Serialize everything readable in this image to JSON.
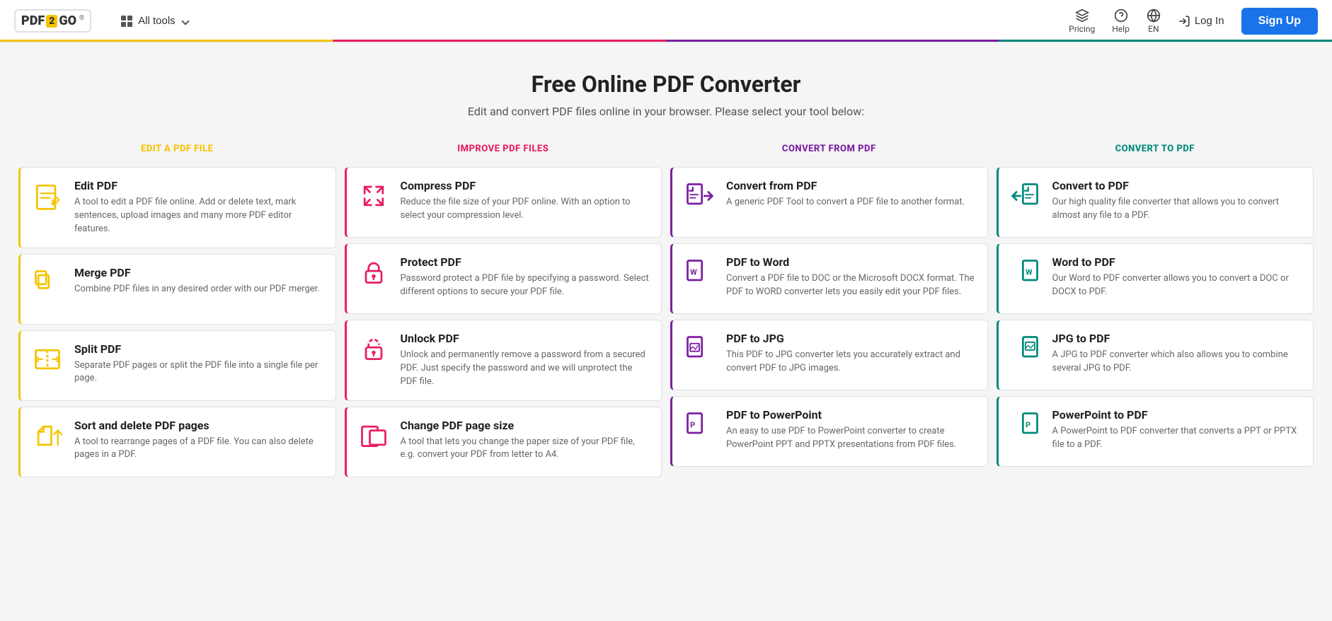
{
  "header": {
    "logo_pdf": "PDF",
    "logo_2": "2",
    "logo_go": "GO",
    "logo_tag": "®",
    "all_tools": "All tools",
    "pricing": "Pricing",
    "help": "Help",
    "lang": "EN",
    "login": "Log In",
    "signup": "Sign Up"
  },
  "hero": {
    "title": "Free Online PDF Converter",
    "subtitle": "Edit and convert PDF files online in your browser. Please select your tool below:"
  },
  "columns": [
    {
      "id": "edit",
      "header": "EDIT A PDF FILE",
      "color": "#f5c400",
      "tools": [
        {
          "name": "Edit PDF",
          "desc": "A tool to edit a PDF file online. Add or delete text, mark sentences, upload images and many more PDF editor features.",
          "icon": "edit"
        },
        {
          "name": "Merge PDF",
          "desc": "Combine PDF files in any desired order with our PDF merger.",
          "icon": "merge"
        },
        {
          "name": "Split PDF",
          "desc": "Separate PDF pages or split the PDF file into a single file per page.",
          "icon": "split"
        },
        {
          "name": "Sort and delete PDF pages",
          "desc": "A tool to rearrange pages of a PDF file. You can also delete pages in a PDF.",
          "icon": "sort"
        }
      ]
    },
    {
      "id": "improve",
      "header": "IMPROVE PDF FILES",
      "color": "#e91e63",
      "tools": [
        {
          "name": "Compress PDF",
          "desc": "Reduce the file size of your PDF online. With an option to select your compression level.",
          "icon": "compress"
        },
        {
          "name": "Protect PDF",
          "desc": "Password protect a PDF file by specifying a password. Select different options to secure your PDF file.",
          "icon": "protect"
        },
        {
          "name": "Unlock PDF",
          "desc": "Unlock and permanently remove a password from a secured PDF. Just specify the password and we will unprotect the PDF file.",
          "icon": "unlock"
        },
        {
          "name": "Change PDF page size",
          "desc": "A tool that lets you change the paper size of your PDF file, e.g. convert your PDF from letter to A4.",
          "icon": "resize"
        }
      ]
    },
    {
      "id": "convert-from",
      "header": "CONVERT FROM PDF",
      "color": "#7b1fa2",
      "tools": [
        {
          "name": "Convert from PDF",
          "desc": "A generic PDF Tool to convert a PDF file to another format.",
          "icon": "convert-from"
        },
        {
          "name": "PDF to Word",
          "desc": "Convert a PDF file to DOC or the Microsoft DOCX format. The PDF to WORD converter lets you easily edit your PDF files.",
          "icon": "pdf-word"
        },
        {
          "name": "PDF to JPG",
          "desc": "This PDF to JPG converter lets you accurately extract and convert PDF to JPG images.",
          "icon": "pdf-jpg"
        },
        {
          "name": "PDF to PowerPoint",
          "desc": "An easy to use PDF to PowerPoint converter to create PowerPoint PPT and PPTX presentations from PDF files.",
          "icon": "pdf-ppt"
        }
      ]
    },
    {
      "id": "convert-to",
      "header": "CONVERT TO PDF",
      "color": "#00897b",
      "tools": [
        {
          "name": "Convert to PDF",
          "desc": "Our high quality file converter that allows you to convert almost any file to a PDF.",
          "icon": "convert-to"
        },
        {
          "name": "Word to PDF",
          "desc": "Our Word to PDF converter allows you to convert a DOC or DOCX to PDF.",
          "icon": "word-pdf"
        },
        {
          "name": "JPG to PDF",
          "desc": "A JPG to PDF converter which also allows you to combine several JPG to PDF.",
          "icon": "jpg-pdf"
        },
        {
          "name": "PowerPoint to PDF",
          "desc": "A PowerPoint to PDF converter that converts a PPT or PPTX file to a PDF.",
          "icon": "ppt-pdf"
        }
      ]
    }
  ]
}
